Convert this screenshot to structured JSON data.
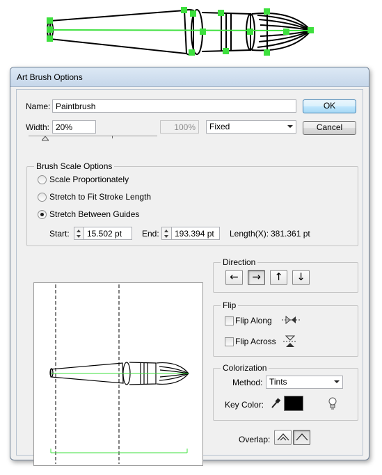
{
  "window": {
    "title": "Art Brush Options"
  },
  "name_field": {
    "label": "Name:",
    "value": "Paintbrush"
  },
  "buttons": {
    "ok": "OK",
    "cancel": "Cancel"
  },
  "width_field": {
    "label": "Width:",
    "value": "20%",
    "max_value": "100%",
    "mode": "Fixed"
  },
  "brush_scale": {
    "title": "Brush Scale Options",
    "options": [
      {
        "label": "Scale Proportionately",
        "checked": false
      },
      {
        "label": "Stretch to Fit Stroke Length",
        "checked": false
      },
      {
        "label": "Stretch Between Guides",
        "checked": true
      }
    ],
    "start_label": "Start:",
    "start_value": "15.502 pt",
    "end_label": "End:",
    "end_value": "193.394 pt",
    "length_label": "Length(X):",
    "length_value": "381.361 pt"
  },
  "direction": {
    "title": "Direction",
    "buttons": [
      {
        "icon": "arrow-left-icon",
        "glyph": "←",
        "active": false
      },
      {
        "icon": "arrow-right-icon",
        "glyph": "→",
        "active": true
      },
      {
        "icon": "arrow-up-icon",
        "glyph": "↑",
        "active": false
      },
      {
        "icon": "arrow-down-icon",
        "glyph": "↓",
        "active": false
      }
    ]
  },
  "flip": {
    "title": "Flip",
    "along_label": "Flip Along",
    "across_label": "Flip Across"
  },
  "colorization": {
    "title": "Colorization",
    "method_label": "Method:",
    "method_value": "Tints",
    "key_color_label": "Key Color:",
    "key_color": "#000000"
  },
  "overlap": {
    "label": "Overlap:"
  },
  "colors": {
    "guide_green": "#3ee03e",
    "accent_blue": "#3c7fb1"
  }
}
